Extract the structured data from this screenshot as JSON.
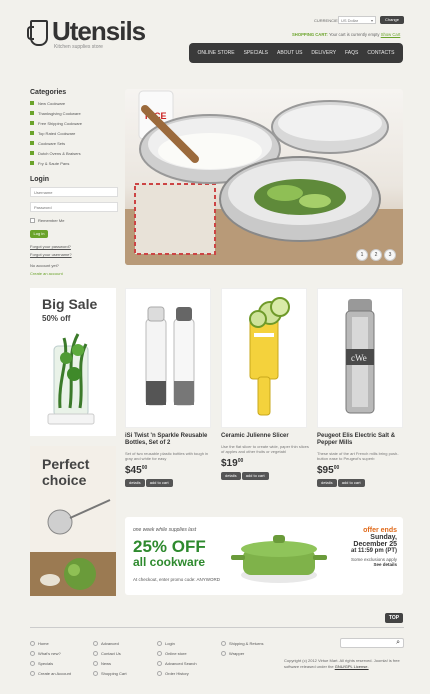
{
  "header": {
    "logo_text": "Utensils",
    "tagline": "Kitchen supplies store",
    "currency_label": "CURRENCIES:",
    "currency_value": "US Dollar",
    "currency_button": "Change",
    "cart_label": "SHOPPING CART:",
    "cart_text": "Your cart is currently empty",
    "cart_link": "Show Cart"
  },
  "nav": [
    "ONLINE STORE",
    "SPECIALS",
    "ABOUT US",
    "DELIVERY",
    "FAQS",
    "CONTACTS"
  ],
  "sidebar": {
    "categories_title": "Categories",
    "categories": [
      "New Cookware",
      "Thanksgiving Cookware",
      "Free Shipping Cookware",
      "Top Rated Cookware",
      "Cookware Sets",
      "Dutch Ovens & Braisers",
      "Fry & Saute Pans"
    ],
    "login_title": "Login",
    "username_placeholder": "Username",
    "password_placeholder": "Password",
    "remember_label": "Remember Me",
    "login_button": "Log in",
    "forgot_password": "Forgot your password?",
    "forgot_username": "Forgot your username?",
    "no_account": "No account yet?",
    "create_account": "Create an account"
  },
  "slider": {
    "pages": [
      "1",
      "2",
      "3"
    ],
    "label_text": "RICE"
  },
  "promos": {
    "sale_big": "Big Sale",
    "sale_sub": "50% off",
    "choice_big": "Perfect",
    "choice_sub": "choice"
  },
  "products": [
    {
      "name": "iSi Twist 'n Sparkle Reusable Bottles, Set of 2",
      "desc": "Set of two reusable plastic bottles with tough in gray and white for easy",
      "price_whole": "$45",
      "price_cents": "00",
      "details": "details",
      "add_to_cart": "add to cart"
    },
    {
      "name": "Ceramic Julienne Slicer",
      "desc": "Use the flat slicer to create wide, paper thin slices of apples and other fruits or vegetabl",
      "price_whole": "$19",
      "price_cents": "00",
      "details": "details",
      "add_to_cart": "add to cart"
    },
    {
      "name": "Peugeot Elis Electric Salt & Pepper Mills",
      "desc": "These state of the art French mills bring push-button ease to Peugeot's superb",
      "price_whole": "$95",
      "price_cents": "00",
      "details": "details",
      "add_to_cart": "add to cart"
    }
  ],
  "banner": {
    "kicker": "one week while supplies last",
    "headline_1": "25% OFF",
    "headline_2": "all cookware",
    "promo_code": "At checkout, enter promo code: ANYWORD",
    "offer_1": "offer ends",
    "offer_2": "Sunday,",
    "offer_3": "December 25",
    "offer_4": "at 11:59 pm (PT)",
    "exclusions": "Some exclusions apply",
    "see_details": "See details"
  },
  "footer": {
    "top_button": "TOP",
    "columns": [
      [
        "Home",
        "What's new?",
        "Specials",
        "Create an Account"
      ],
      [
        "Advanced",
        "Contact Us",
        "News",
        "Shopping Cart"
      ],
      [
        "Login",
        "Online store",
        "Advanced Search",
        "Order History"
      ],
      [
        "Shipping & Returns",
        "Wrapper"
      ]
    ],
    "copyright": "Copyright (c) 2012 Virtue Mart. All rights reserved. Joomla! is free software released under the ",
    "license_link": "GNU/GPL License."
  },
  "colors": {
    "accent": "#6aa32a",
    "nav_bg": "#3a3a3a",
    "promo_green": "#2e8a2e",
    "offer_orange": "#e06a1a"
  }
}
